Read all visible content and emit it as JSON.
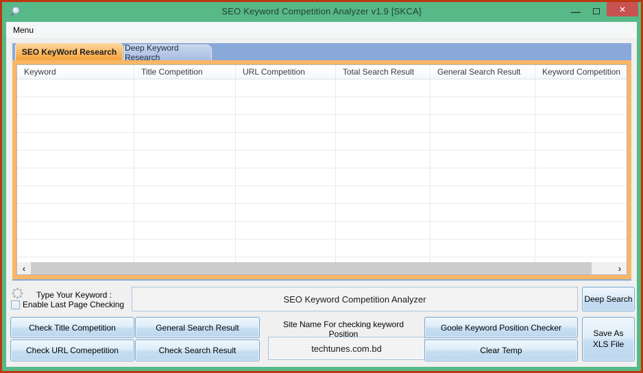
{
  "window": {
    "title": "SEO Keyword Competition Analyzer v1.9 [SKCA]",
    "icons": {
      "minimize": "—",
      "close": "✕",
      "scroll_left": "‹",
      "scroll_right": "›"
    }
  },
  "menu_bar": {
    "items": [
      {
        "label": "Menu"
      }
    ]
  },
  "tabs": [
    {
      "label": "SEO KeyWord Research",
      "active": true
    },
    {
      "label": "Deep Keyword Research",
      "active": false
    }
  ],
  "table": {
    "columns": [
      "Keyword",
      "Title Competition",
      "URL Competition",
      "Total Search Result",
      "General Search Result",
      "Keyword Competition"
    ],
    "rows": []
  },
  "controls": {
    "type_keyword_label": "Type Your Keyword :",
    "enable_last_page_label": "Enable Last Page Checking",
    "enable_last_page_checked": false,
    "keyword_input_value": "SEO Keyword Competition Analyzer",
    "deep_search_button": "Deep Search",
    "check_title_button": "Check Title Competition",
    "general_search_button": "General Search Result",
    "check_url_button": "Check URL Comepetition",
    "check_search_button": "Check Search Result",
    "site_name_label": "Site Name For checking keyword Position",
    "site_name_value": "techtunes.com.bd",
    "google_position_button": "Goole Keyword Position Checker",
    "clear_temp_button": "Clear Temp",
    "save_xls_button": "Save As XLS File"
  },
  "colors": {
    "titlebar_green": "#57b987",
    "outer_border_red": "#bb3810",
    "close_button_red": "#c85250",
    "tab_strip_blue": "#89a9d8",
    "active_tab_orange": "#f8ae52",
    "panel_orange": "#f9b665",
    "button_blue": "#bdd7ee",
    "client_gray": "#f0f0f0"
  }
}
